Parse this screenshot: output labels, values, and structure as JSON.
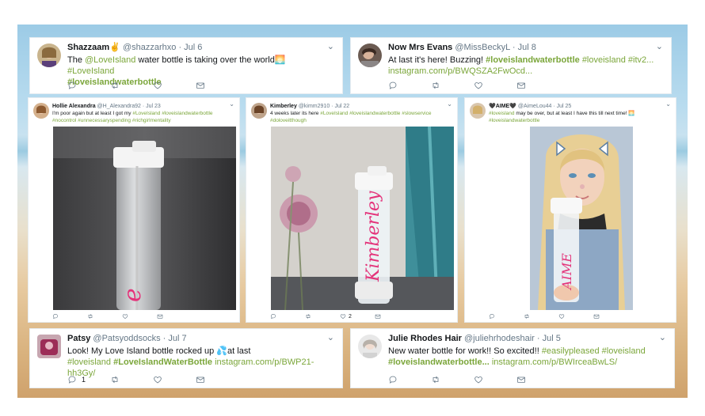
{
  "tweets_top": [
    {
      "name": "Shazzaam",
      "emoji": "✌",
      "handle": "@shazzarhxo",
      "date": "· Jul 6",
      "text_a": "The ",
      "mention": "@LoveIsland",
      "text_b": " water bottle is taking over the world",
      "text_emoji": "🌅",
      "tag1": "#LoveIsland",
      "tag2": "#loveislandwaterbottle"
    },
    {
      "name": "Now Mrs Evans",
      "handle": "@MissBeckyL",
      "date": "· Jul 8",
      "text_a": "At last it's here! Buzzing! ",
      "tag1": "#loveislandwaterbottle",
      "tag2": "#loveisland",
      "tag3": "#itv2...",
      "link": "instagram.com/p/BWQSZA2FwOcd..."
    }
  ],
  "tweets_mid": [
    {
      "name": "Hollie Alexandra",
      "handle": "@H_Alexandra92",
      "date": "· Jul 23",
      "text_a": "I'm poor again but at least I got my ",
      "tag1": "#LoveIsland",
      "tag2": "#loveislandwaterbottle",
      "tag3": "#nocontrol",
      "tag4": "#unnecessaryspending",
      "tag5": "#richgirlmentality",
      "bottle_text": "e"
    },
    {
      "name": "Kimberley",
      "handle": "@kimm2910",
      "date": "· Jul 22",
      "text_a": "4 weeks later its here ",
      "tag1": "#LoveIsland",
      "tag2": "#loveislandwaterbottle",
      "tag3": "#slowservice",
      "tag4": "#doloveitthough",
      "retweets": "2",
      "bottle_text": "Kimberley"
    },
    {
      "name": "AIME",
      "name_pre": "🖤",
      "name_post": "🖤",
      "handle": "@AimeLou44",
      "date": "· Jul 25",
      "tag1": "#loveisland",
      "text_a": " may be over, but at least I have this till next time! ",
      "text_emoji": "🌅",
      "tag2": "#loveislandwaterbottle",
      "bottle_text": "AIME"
    }
  ],
  "tweets_bottom": [
    {
      "name": "Patsy",
      "handle": "@Patsyoddsocks",
      "date": "· Jul 7",
      "text_a": "Look! My Love Island bottle rocked up ",
      "text_emoji": "💦",
      "text_b": "at last",
      "tag1": "#loveisland",
      "tag2": "#LoveIslandWaterBottle",
      "link": "instagram.com/p/BWP21-hh3Gy/",
      "replies": "1"
    },
    {
      "name": "Julie Rhodes Hair",
      "handle": "@juliehrhodeshair",
      "date": "· Jul 5",
      "text_a": "New water bottle for work!! So excited!! ",
      "tag1": "#easilypleased",
      "tag2": "#loveisland",
      "tag3": "#loveislandwaterbottle...",
      "link": "instagram.com/p/BWIrceaBwLS/"
    }
  ],
  "icons": {
    "reply": "reply-icon",
    "retweet": "retweet-icon",
    "like": "heart-icon",
    "dm": "envelope-icon",
    "more": "chevron-down-icon"
  },
  "colors": {
    "hashtag": "#7ba63a",
    "text": "#14171a",
    "muted": "#657786",
    "bottle_pink": "#e4337a"
  }
}
